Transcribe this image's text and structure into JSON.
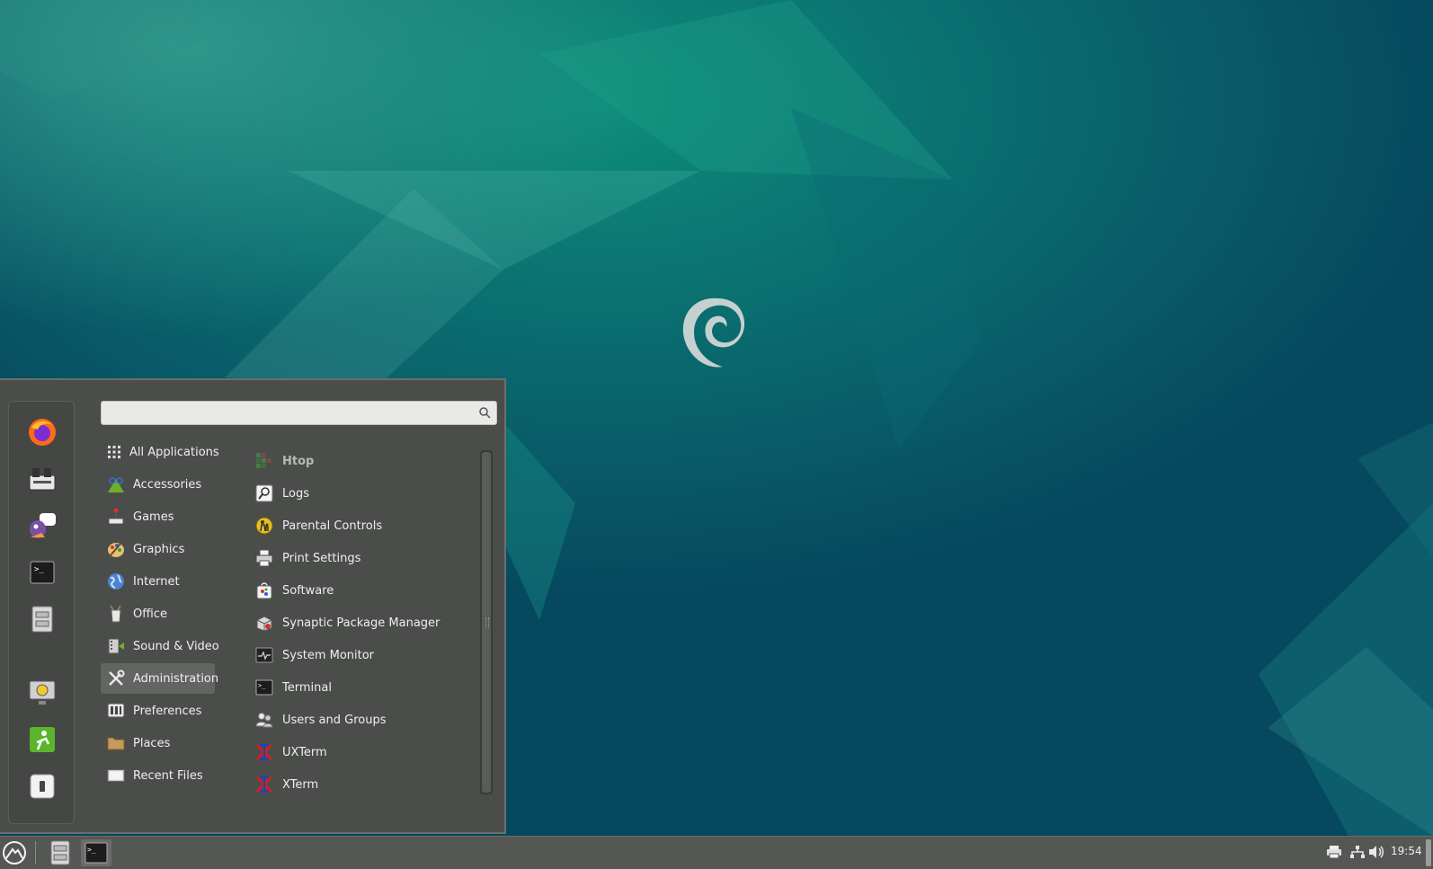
{
  "menu": {
    "search": {
      "placeholder": "",
      "value": ""
    },
    "favorites": [
      {
        "name": "firefox-icon"
      },
      {
        "name": "software-manager-icon"
      },
      {
        "name": "pidgin-icon"
      },
      {
        "name": "terminal-icon"
      },
      {
        "name": "file-manager-icon"
      },
      {
        "name": "lock-screen-icon"
      },
      {
        "name": "logout-icon"
      },
      {
        "name": "shutdown-icon"
      }
    ],
    "categories": [
      {
        "label": "All Applications",
        "icon": "grid-icon"
      },
      {
        "label": "Accessories",
        "icon": "accessories-icon"
      },
      {
        "label": "Games",
        "icon": "games-icon"
      },
      {
        "label": "Graphics",
        "icon": "graphics-icon"
      },
      {
        "label": "Internet",
        "icon": "globe-icon"
      },
      {
        "label": "Office",
        "icon": "office-icon"
      },
      {
        "label": "Sound & Video",
        "icon": "multimedia-icon"
      },
      {
        "label": "Administration",
        "icon": "tools-icon",
        "active": true
      },
      {
        "label": "Preferences",
        "icon": "preferences-icon"
      },
      {
        "label": "Places",
        "icon": "folder-icon"
      },
      {
        "label": "Recent Files",
        "icon": "recent-files-icon"
      }
    ],
    "apps": [
      {
        "label": "Htop",
        "icon": "htop-icon",
        "dim": true
      },
      {
        "label": "Logs",
        "icon": "logs-icon"
      },
      {
        "label": "Parental Controls",
        "icon": "parental-controls-icon"
      },
      {
        "label": "Print Settings",
        "icon": "printer-icon"
      },
      {
        "label": "Software",
        "icon": "software-icon"
      },
      {
        "label": "Synaptic Package Manager",
        "icon": "synaptic-icon"
      },
      {
        "label": "System Monitor",
        "icon": "system-monitor-icon"
      },
      {
        "label": "Terminal",
        "icon": "terminal-icon"
      },
      {
        "label": "Users and Groups",
        "icon": "users-icon"
      },
      {
        "label": "UXTerm",
        "icon": "xterm-icon"
      },
      {
        "label": "XTerm",
        "icon": "xterm-icon"
      }
    ]
  },
  "panel": {
    "clock": "19:54",
    "tray": [
      "printer-icon",
      "network-icon",
      "volume-icon"
    ]
  },
  "colors": {
    "accent": "#0e8a78",
    "background": "#06495e",
    "menu_bg": "#4b4d4b",
    "panel_bg": "#555755"
  }
}
